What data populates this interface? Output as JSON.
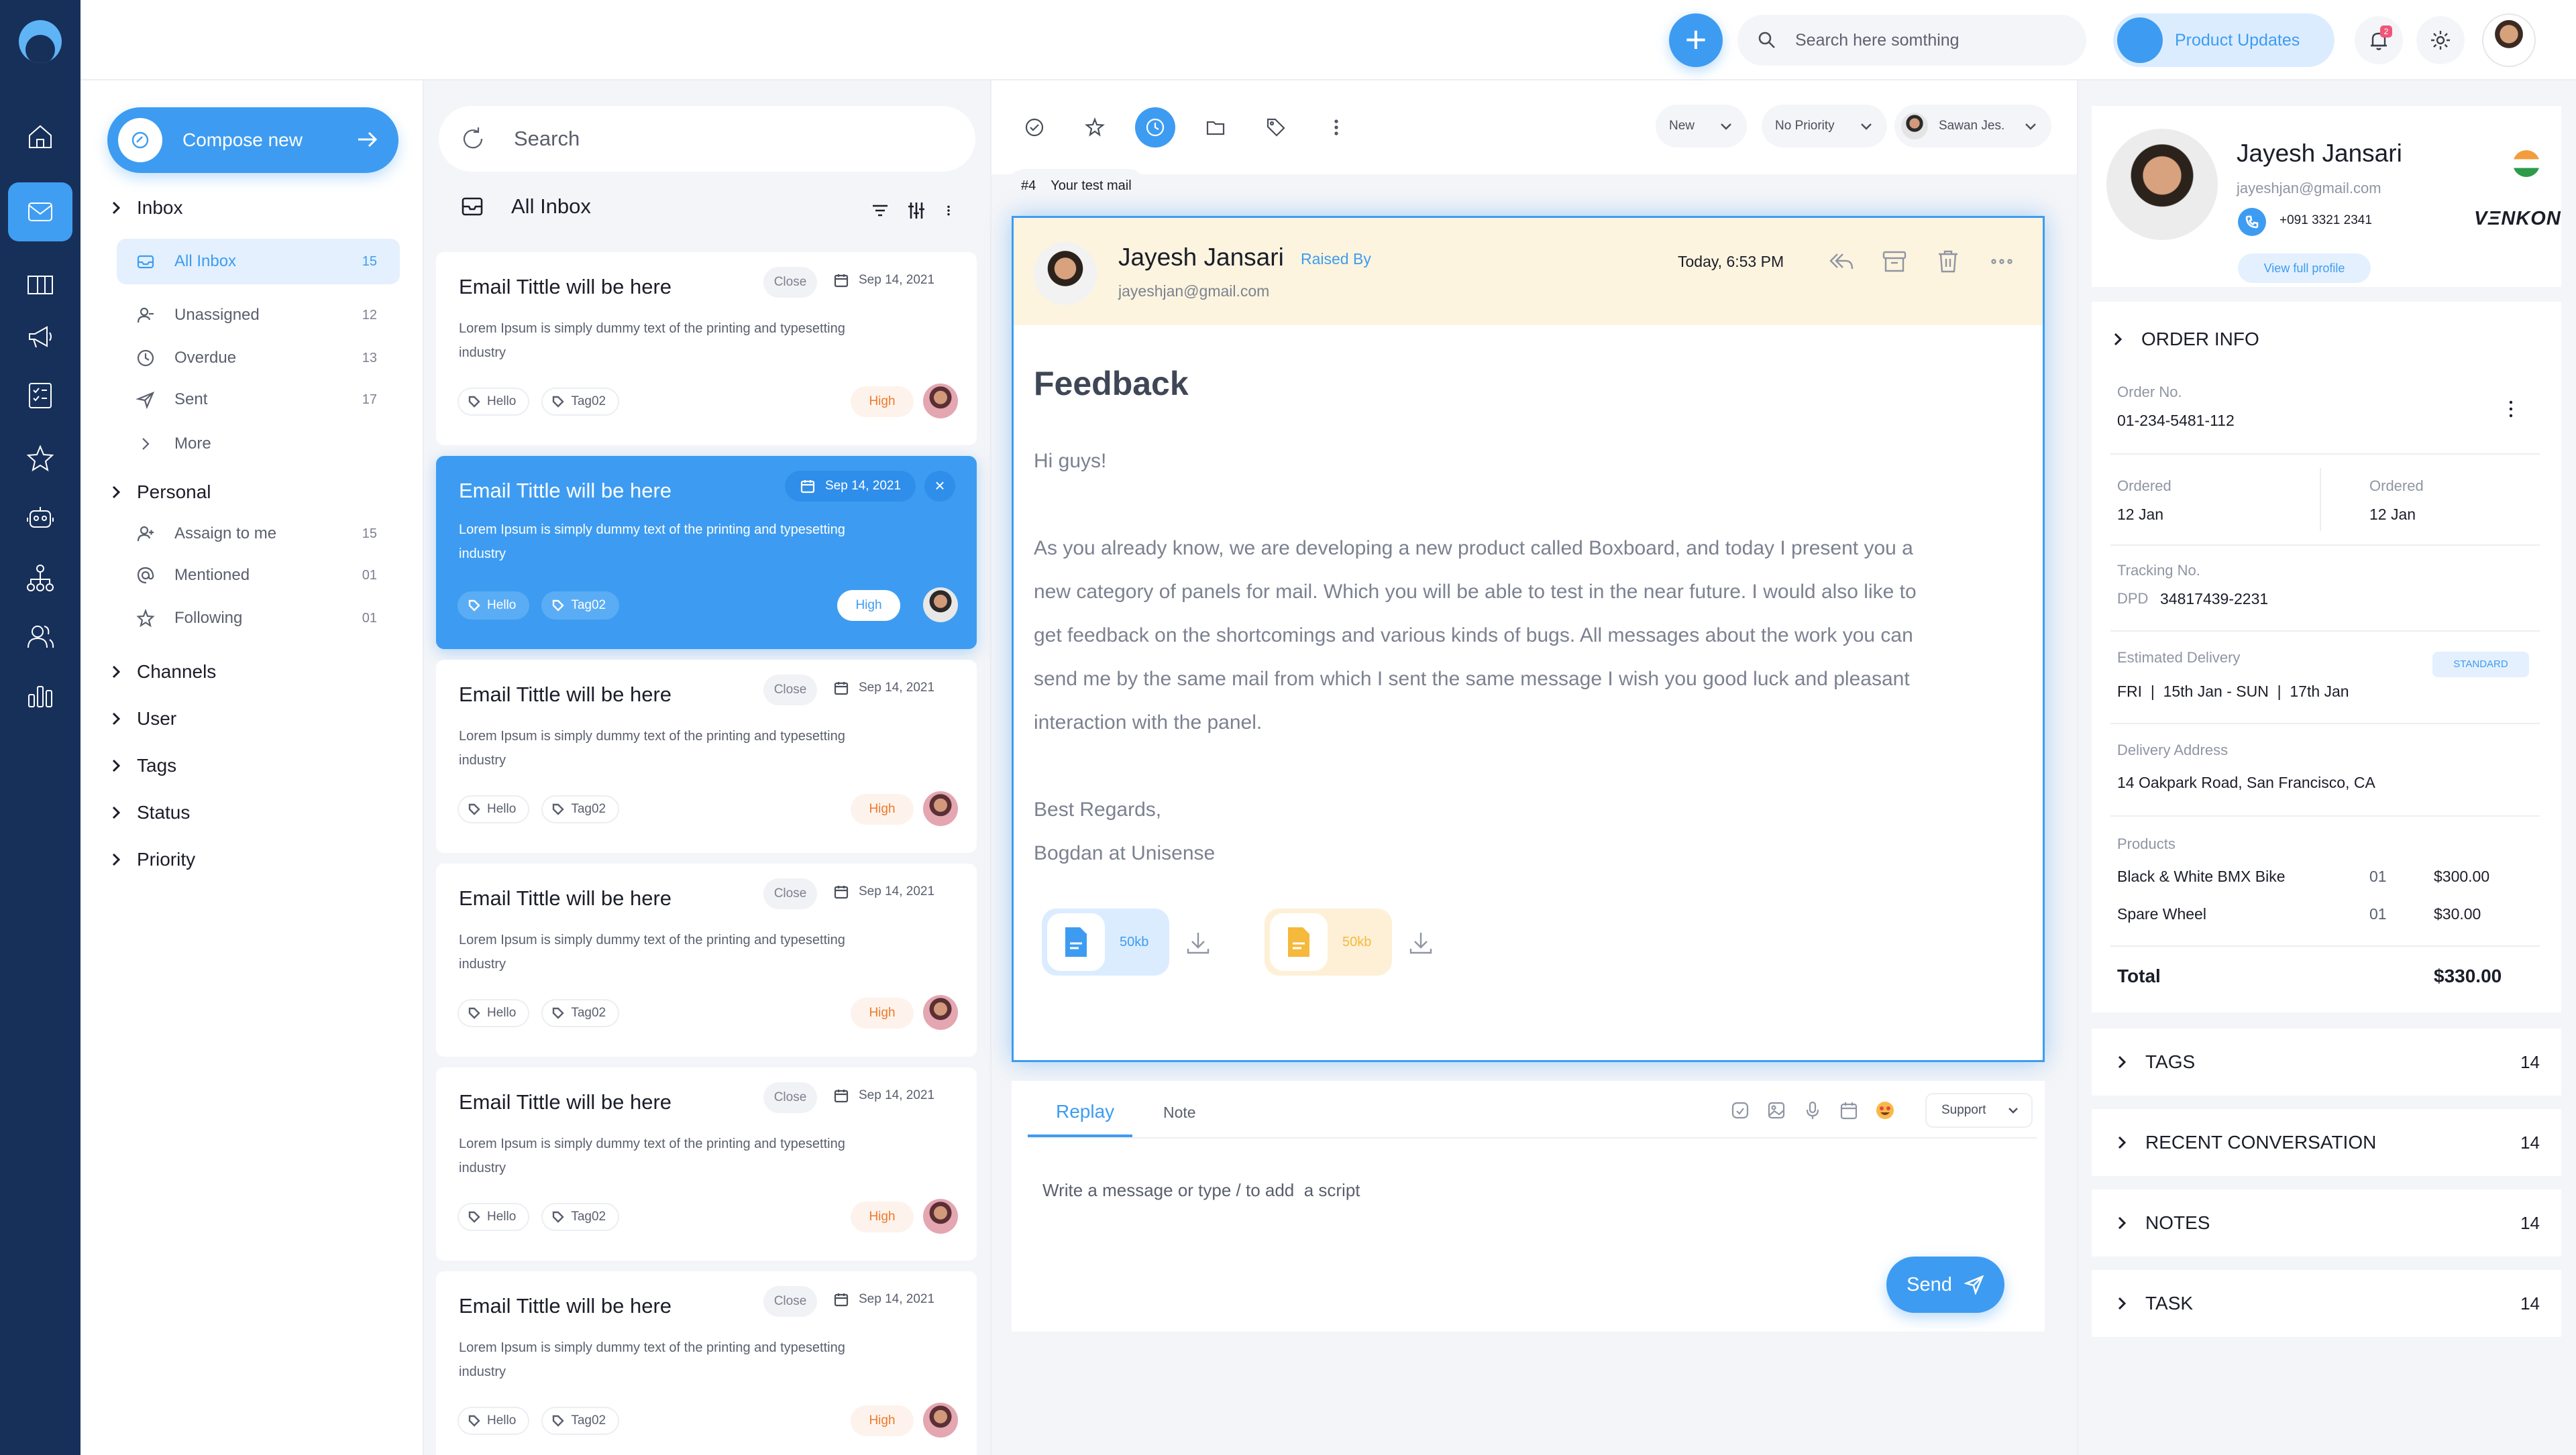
{
  "topbar": {
    "search_placeholder": "Search here somthing",
    "updates_label": "Product Updates",
    "bell_badge": "2"
  },
  "folders": {
    "compose_label": "Compose new",
    "inbox_label": "Inbox",
    "inbox_items": [
      {
        "label": "All Inbox",
        "count": "15"
      },
      {
        "label": "Unassigned",
        "count": "12"
      },
      {
        "label": "Overdue",
        "count": "13"
      },
      {
        "label": "Sent",
        "count": "17"
      },
      {
        "label": "More",
        "count": ""
      }
    ],
    "personal_label": "Personal",
    "personal_items": [
      {
        "label": "Assaign to me",
        "count": "15"
      },
      {
        "label": "Mentioned",
        "count": "01"
      },
      {
        "label": "Following",
        "count": "01"
      }
    ],
    "sections": [
      "Channels",
      "User",
      "Tags",
      "Status",
      "Priority"
    ]
  },
  "maillist": {
    "search_placeholder": "Search",
    "title": "All Inbox",
    "mails": [
      {
        "subject": "Email Tittle will be here",
        "close": "Close",
        "date": "Sep 14, 2021",
        "body": "Lorem Ipsum is simply dummy text of the printing and typesetting industry",
        "tags": [
          "Hello",
          "Tag02"
        ],
        "priority": "High"
      },
      {
        "subject": "Email Tittle will be here",
        "close": "",
        "date": "Sep 14, 2021",
        "body": "Lorem Ipsum is simply dummy text of the printing and typesetting industry",
        "tags": [
          "Hello",
          "Tag02"
        ],
        "priority": "High"
      },
      {
        "subject": "Email Tittle will be here",
        "close": "Close",
        "date": "Sep 14, 2021",
        "body": "Lorem Ipsum is simply dummy text of the printing and typesetting industry",
        "tags": [
          "Hello",
          "Tag02"
        ],
        "priority": "High"
      },
      {
        "subject": "Email Tittle will be here",
        "close": "Close",
        "date": "Sep 14, 2021",
        "body": "Lorem Ipsum is simply dummy text of the printing and typesetting industry",
        "tags": [
          "Hello",
          "Tag02"
        ],
        "priority": "High"
      },
      {
        "subject": "Email Tittle will be here",
        "close": "Close",
        "date": "Sep 14, 2021",
        "body": "Lorem Ipsum is simply dummy text of the printing and typesetting industry",
        "tags": [
          "Hello",
          "Tag02"
        ],
        "priority": "High"
      },
      {
        "subject": "Email Tittle will be here",
        "close": "Close",
        "date": "Sep 14, 2021",
        "body": "Lorem Ipsum is simply dummy text of the printing and typesetting industry",
        "tags": [
          "Hello",
          "Tag02"
        ],
        "priority": "High"
      }
    ]
  },
  "message": {
    "filter_status": "New",
    "filter_priority": "No Priority",
    "filter_assignee": "Sawan Jes.",
    "ticket_no": "#4",
    "ticket_title": "Your test mail",
    "sender_name": "Jayesh Jansari",
    "raised_by": "Raised By",
    "sender_email": "jayeshjan@gmail.com",
    "time": "Today, 6:53 PM",
    "title": "Feedback",
    "greeting": "Hi guys!",
    "paragraph": "As you already know, we are developing a new product called Boxboard, and today I present you a new category of panels for mail. Which you will be able to test in the near future. I would also like to get feedback on the shortcomings and various kinds of bugs. All messages about the work you can send me by the same mail from which I sent the same message I wish you good luck and pleasant interaction with the panel.",
    "signoff": "Best Regards,",
    "signature": "Bogdan at Unisense",
    "attachments": [
      {
        "size": "50kb",
        "color": "#3d9cf1"
      },
      {
        "size": "50kb",
        "color": "#f5b93c"
      }
    ]
  },
  "reply": {
    "tab_reply": "Replay",
    "tab_note": "Note",
    "support_label": "Support",
    "placeholder": "Write a message or type / to add  a script",
    "send_label": "Send"
  },
  "profile": {
    "name": "Jayesh Jansari",
    "email": "jayeshjan@gmail.com",
    "phone": "+091 3321 2341",
    "company": "VΞNKON",
    "view_label": "View full profile"
  },
  "order": {
    "header": "ORDER INFO",
    "order_no_label": "Order No.",
    "order_no": "01-234-5481-112",
    "ordered_label": "Ordered",
    "ordered_1": "12 Jan",
    "ordered_2": "12 Jan",
    "tracking_label": "Tracking No.",
    "tracking_carrier": "DPD",
    "tracking_no": "34817439-2231",
    "delivery_label": "Estimated Delivery",
    "delivery_badge": "STANDARD",
    "delivery_value": "FRI  |  15th Jan - SUN  |  17th Jan",
    "address_label": "Delivery Address",
    "address": "14 Oakpark Road, San Francisco, CA",
    "products_label": "Products",
    "products": [
      {
        "name": "Black & White BMX Bike",
        "qty": "01",
        "price": "$300.00"
      },
      {
        "name": "Spare Wheel",
        "qty": "01",
        "price": "$30.00"
      }
    ],
    "total_label": "Total",
    "total": "$330.00"
  },
  "accordions": [
    {
      "label": "TAGS",
      "count": "14"
    },
    {
      "label": "RECENT CONVERSATION",
      "count": "14"
    },
    {
      "label": "NOTES",
      "count": "14"
    },
    {
      "label": "TASK",
      "count": "14"
    }
  ]
}
